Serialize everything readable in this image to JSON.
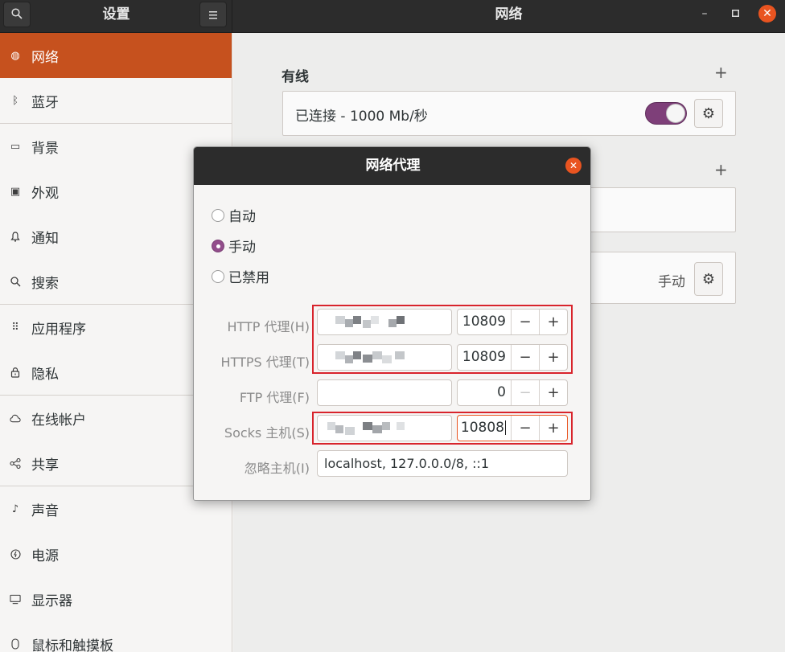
{
  "header": {
    "left_title": "设置",
    "right_title": "网络",
    "search_icon": "search-icon",
    "menu_icon": "hamburger-menu-icon",
    "minimize_label": "–",
    "maximize_label": "□",
    "close_label": "✕"
  },
  "sidebar": {
    "items": [
      {
        "label": "网络",
        "icon": "globe-icon",
        "glyph": "◍"
      },
      {
        "label": "蓝牙",
        "icon": "bluetooth-icon",
        "glyph": "ᛒ"
      },
      {
        "label": "背景",
        "icon": "monitor-icon",
        "glyph": "▭"
      },
      {
        "label": "外观",
        "icon": "appearance-icon",
        "glyph": "▣"
      },
      {
        "label": "通知",
        "icon": "bell-icon",
        "glyph": "♫"
      },
      {
        "label": "搜索",
        "icon": "search-icon",
        "glyph": "⚲"
      },
      {
        "label": "应用程序",
        "icon": "apps-grid-icon",
        "glyph": "⠿"
      },
      {
        "label": "隐私",
        "icon": "lock-icon",
        "glyph": "🔒"
      },
      {
        "label": "在线帐户",
        "icon": "cloud-icon",
        "glyph": "☁"
      },
      {
        "label": "共享",
        "icon": "share-icon",
        "glyph": "⋖"
      },
      {
        "label": "声音",
        "icon": "music-note-icon",
        "glyph": "♪"
      },
      {
        "label": "电源",
        "icon": "power-icon",
        "glyph": "⏻"
      },
      {
        "label": "显示器",
        "icon": "display-icon",
        "glyph": "▭"
      },
      {
        "label": "鼠标和触摸板",
        "icon": "mouse-icon",
        "glyph": "▯"
      }
    ]
  },
  "main": {
    "wired_title": "有线",
    "wired_connection": "已连接 - 1000 Mb/秒",
    "add_label": "+",
    "proxy_state": "手动",
    "gear_glyph": "⚙"
  },
  "dialog": {
    "title": "网络代理",
    "close_label": "✕",
    "options": [
      {
        "label": "自动",
        "selected": false
      },
      {
        "label": "手动",
        "selected": true
      },
      {
        "label": "已禁用",
        "selected": false
      }
    ],
    "fields": [
      {
        "label": "HTTP 代理(H)",
        "port": "10809",
        "minus": "−",
        "plus": "+"
      },
      {
        "label": "HTTPS 代理(T)",
        "port": "10809",
        "minus": "−",
        "plus": "+"
      },
      {
        "label": "FTP 代理(F)",
        "port": "0",
        "minus": "−",
        "plus": "+"
      },
      {
        "label": "Socks 主机(S)",
        "port": "10808",
        "minus": "−",
        "plus": "+"
      }
    ],
    "ignore_label": "忽略主机(I)",
    "ignore_value": "localhost, 127.0.0.0/8, ::1"
  },
  "colors": {
    "accent": "#e95420",
    "sidebar_active": "#c6511e",
    "toggle_on": "#7e3f79",
    "highlight_box": "#d8242c"
  }
}
